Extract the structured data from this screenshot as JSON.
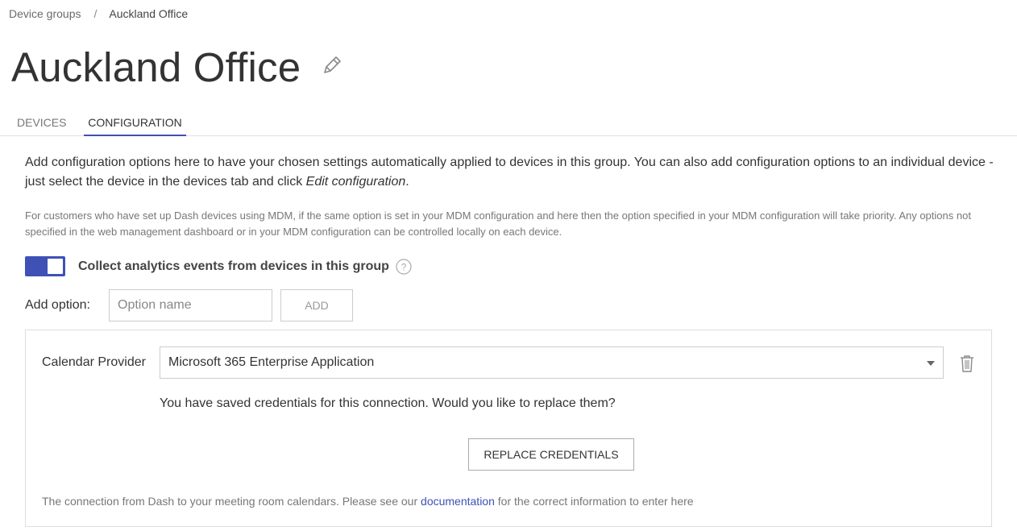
{
  "breadcrumb": {
    "parent": "Device groups",
    "separator": "/",
    "current": "Auckland Office"
  },
  "title": "Auckland Office",
  "tabs": [
    {
      "label": "DEVICES",
      "active": false
    },
    {
      "label": "CONFIGURATION",
      "active": true
    }
  ],
  "intro": {
    "text_before": "Add configuration options here to have your chosen settings automatically applied to devices in this group. You can also add configuration options to an individual device - just select the device in the devices tab and click ",
    "emphasis": "Edit configuration",
    "text_after": "."
  },
  "note": "For customers who have set up Dash devices using MDM, if the same option is set in your MDM configuration and here then the option specified in your MDM configuration will take priority. Any options not specified in the web management dashboard or in your MDM configuration can be controlled locally on each device.",
  "analytics_toggle": {
    "label": "Collect analytics events from devices in this group",
    "enabled": true
  },
  "add_option": {
    "label": "Add option:",
    "placeholder": "Option name",
    "button": "ADD"
  },
  "calendar_provider": {
    "label": "Calendar Provider",
    "selected": "Microsoft 365 Enterprise Application",
    "credentials_text": "You have saved credentials for this connection. Would you like to replace them?",
    "replace_button": "REPLACE CREDENTIALS",
    "help_before": "The connection from Dash to your meeting room calendars. Please see our ",
    "help_link": "documentation",
    "help_after": " for the correct information to enter here"
  },
  "colors": {
    "accent": "#3f51b5",
    "text": "#333333",
    "muted": "#777777",
    "border": "#cccccc"
  },
  "icons": {
    "edit": "pencil-icon",
    "help": "question-circle-icon",
    "delete": "trash-icon",
    "dropdown": "chevron-down-icon"
  }
}
